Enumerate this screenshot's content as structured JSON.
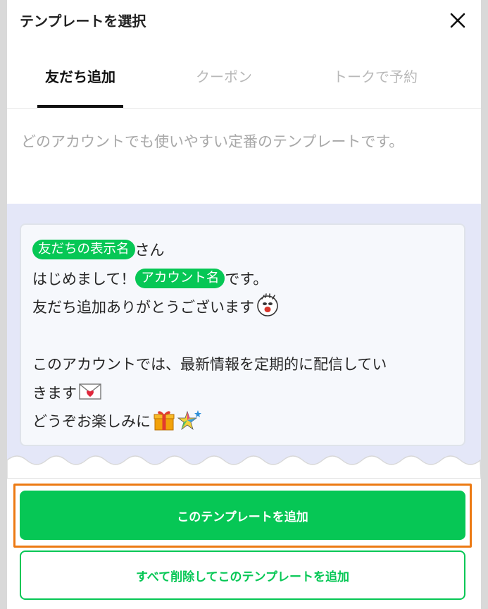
{
  "header": {
    "title": "テンプレートを選択",
    "close_icon": "close-icon"
  },
  "tabs": [
    {
      "label": "友だち追加",
      "active": true
    },
    {
      "label": "クーポン",
      "active": false
    },
    {
      "label": "トークで予約",
      "active": false
    }
  ],
  "description": "どのアカウントでも使いやすい定番のテンプレートです。",
  "message": {
    "friend_name_tag": "友だちの表示名",
    "line1_suffix": "さん",
    "line2_prefix": "はじめまして！",
    "account_name_tag": "アカウント名",
    "line2_suffix": "です。",
    "line3": "友だち追加ありがとうございます",
    "line4": "このアカウントでは、最新情報を定期的に配信してい",
    "line5": "きます",
    "line6": "どうぞお楽しみに",
    "emojis": [
      "cheering-face-emoji",
      "love-letter-emoji",
      "gift-emoji",
      "shooting-star-emoji"
    ]
  },
  "buttons": {
    "add_template": "このテンプレートを追加",
    "replace_template": "すべて削除してこのテンプレートを追加"
  },
  "colors": {
    "accent": "#06c755",
    "highlight": "#ec7a13",
    "preview_bg": "#e4e7f8"
  }
}
